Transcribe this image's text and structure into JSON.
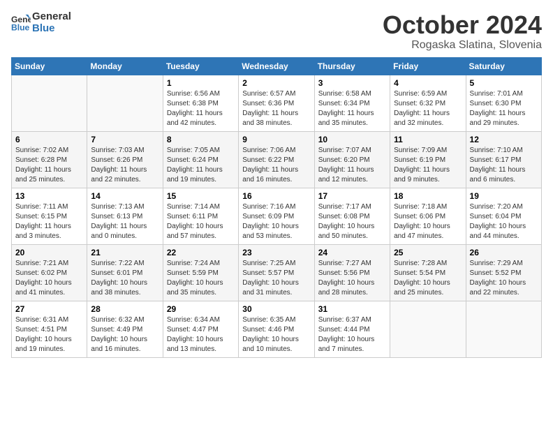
{
  "header": {
    "logo_line1": "General",
    "logo_line2": "Blue",
    "month": "October 2024",
    "location": "Rogaska Slatina, Slovenia"
  },
  "weekdays": [
    "Sunday",
    "Monday",
    "Tuesday",
    "Wednesday",
    "Thursday",
    "Friday",
    "Saturday"
  ],
  "weeks": [
    [
      {
        "day": "",
        "sunrise": "",
        "sunset": "",
        "daylight": ""
      },
      {
        "day": "",
        "sunrise": "",
        "sunset": "",
        "daylight": ""
      },
      {
        "day": "1",
        "sunrise": "Sunrise: 6:56 AM",
        "sunset": "Sunset: 6:38 PM",
        "daylight": "Daylight: 11 hours and 42 minutes."
      },
      {
        "day": "2",
        "sunrise": "Sunrise: 6:57 AM",
        "sunset": "Sunset: 6:36 PM",
        "daylight": "Daylight: 11 hours and 38 minutes."
      },
      {
        "day": "3",
        "sunrise": "Sunrise: 6:58 AM",
        "sunset": "Sunset: 6:34 PM",
        "daylight": "Daylight: 11 hours and 35 minutes."
      },
      {
        "day": "4",
        "sunrise": "Sunrise: 6:59 AM",
        "sunset": "Sunset: 6:32 PM",
        "daylight": "Daylight: 11 hours and 32 minutes."
      },
      {
        "day": "5",
        "sunrise": "Sunrise: 7:01 AM",
        "sunset": "Sunset: 6:30 PM",
        "daylight": "Daylight: 11 hours and 29 minutes."
      }
    ],
    [
      {
        "day": "6",
        "sunrise": "Sunrise: 7:02 AM",
        "sunset": "Sunset: 6:28 PM",
        "daylight": "Daylight: 11 hours and 25 minutes."
      },
      {
        "day": "7",
        "sunrise": "Sunrise: 7:03 AM",
        "sunset": "Sunset: 6:26 PM",
        "daylight": "Daylight: 11 hours and 22 minutes."
      },
      {
        "day": "8",
        "sunrise": "Sunrise: 7:05 AM",
        "sunset": "Sunset: 6:24 PM",
        "daylight": "Daylight: 11 hours and 19 minutes."
      },
      {
        "day": "9",
        "sunrise": "Sunrise: 7:06 AM",
        "sunset": "Sunset: 6:22 PM",
        "daylight": "Daylight: 11 hours and 16 minutes."
      },
      {
        "day": "10",
        "sunrise": "Sunrise: 7:07 AM",
        "sunset": "Sunset: 6:20 PM",
        "daylight": "Daylight: 11 hours and 12 minutes."
      },
      {
        "day": "11",
        "sunrise": "Sunrise: 7:09 AM",
        "sunset": "Sunset: 6:19 PM",
        "daylight": "Daylight: 11 hours and 9 minutes."
      },
      {
        "day": "12",
        "sunrise": "Sunrise: 7:10 AM",
        "sunset": "Sunset: 6:17 PM",
        "daylight": "Daylight: 11 hours and 6 minutes."
      }
    ],
    [
      {
        "day": "13",
        "sunrise": "Sunrise: 7:11 AM",
        "sunset": "Sunset: 6:15 PM",
        "daylight": "Daylight: 11 hours and 3 minutes."
      },
      {
        "day": "14",
        "sunrise": "Sunrise: 7:13 AM",
        "sunset": "Sunset: 6:13 PM",
        "daylight": "Daylight: 11 hours and 0 minutes."
      },
      {
        "day": "15",
        "sunrise": "Sunrise: 7:14 AM",
        "sunset": "Sunset: 6:11 PM",
        "daylight": "Daylight: 10 hours and 57 minutes."
      },
      {
        "day": "16",
        "sunrise": "Sunrise: 7:16 AM",
        "sunset": "Sunset: 6:09 PM",
        "daylight": "Daylight: 10 hours and 53 minutes."
      },
      {
        "day": "17",
        "sunrise": "Sunrise: 7:17 AM",
        "sunset": "Sunset: 6:08 PM",
        "daylight": "Daylight: 10 hours and 50 minutes."
      },
      {
        "day": "18",
        "sunrise": "Sunrise: 7:18 AM",
        "sunset": "Sunset: 6:06 PM",
        "daylight": "Daylight: 10 hours and 47 minutes."
      },
      {
        "day": "19",
        "sunrise": "Sunrise: 7:20 AM",
        "sunset": "Sunset: 6:04 PM",
        "daylight": "Daylight: 10 hours and 44 minutes."
      }
    ],
    [
      {
        "day": "20",
        "sunrise": "Sunrise: 7:21 AM",
        "sunset": "Sunset: 6:02 PM",
        "daylight": "Daylight: 10 hours and 41 minutes."
      },
      {
        "day": "21",
        "sunrise": "Sunrise: 7:22 AM",
        "sunset": "Sunset: 6:01 PM",
        "daylight": "Daylight: 10 hours and 38 minutes."
      },
      {
        "day": "22",
        "sunrise": "Sunrise: 7:24 AM",
        "sunset": "Sunset: 5:59 PM",
        "daylight": "Daylight: 10 hours and 35 minutes."
      },
      {
        "day": "23",
        "sunrise": "Sunrise: 7:25 AM",
        "sunset": "Sunset: 5:57 PM",
        "daylight": "Daylight: 10 hours and 31 minutes."
      },
      {
        "day": "24",
        "sunrise": "Sunrise: 7:27 AM",
        "sunset": "Sunset: 5:56 PM",
        "daylight": "Daylight: 10 hours and 28 minutes."
      },
      {
        "day": "25",
        "sunrise": "Sunrise: 7:28 AM",
        "sunset": "Sunset: 5:54 PM",
        "daylight": "Daylight: 10 hours and 25 minutes."
      },
      {
        "day": "26",
        "sunrise": "Sunrise: 7:29 AM",
        "sunset": "Sunset: 5:52 PM",
        "daylight": "Daylight: 10 hours and 22 minutes."
      }
    ],
    [
      {
        "day": "27",
        "sunrise": "Sunrise: 6:31 AM",
        "sunset": "Sunset: 4:51 PM",
        "daylight": "Daylight: 10 hours and 19 minutes."
      },
      {
        "day": "28",
        "sunrise": "Sunrise: 6:32 AM",
        "sunset": "Sunset: 4:49 PM",
        "daylight": "Daylight: 10 hours and 16 minutes."
      },
      {
        "day": "29",
        "sunrise": "Sunrise: 6:34 AM",
        "sunset": "Sunset: 4:47 PM",
        "daylight": "Daylight: 10 hours and 13 minutes."
      },
      {
        "day": "30",
        "sunrise": "Sunrise: 6:35 AM",
        "sunset": "Sunset: 4:46 PM",
        "daylight": "Daylight: 10 hours and 10 minutes."
      },
      {
        "day": "31",
        "sunrise": "Sunrise: 6:37 AM",
        "sunset": "Sunset: 4:44 PM",
        "daylight": "Daylight: 10 hours and 7 minutes."
      },
      {
        "day": "",
        "sunrise": "",
        "sunset": "",
        "daylight": ""
      },
      {
        "day": "",
        "sunrise": "",
        "sunset": "",
        "daylight": ""
      }
    ]
  ]
}
